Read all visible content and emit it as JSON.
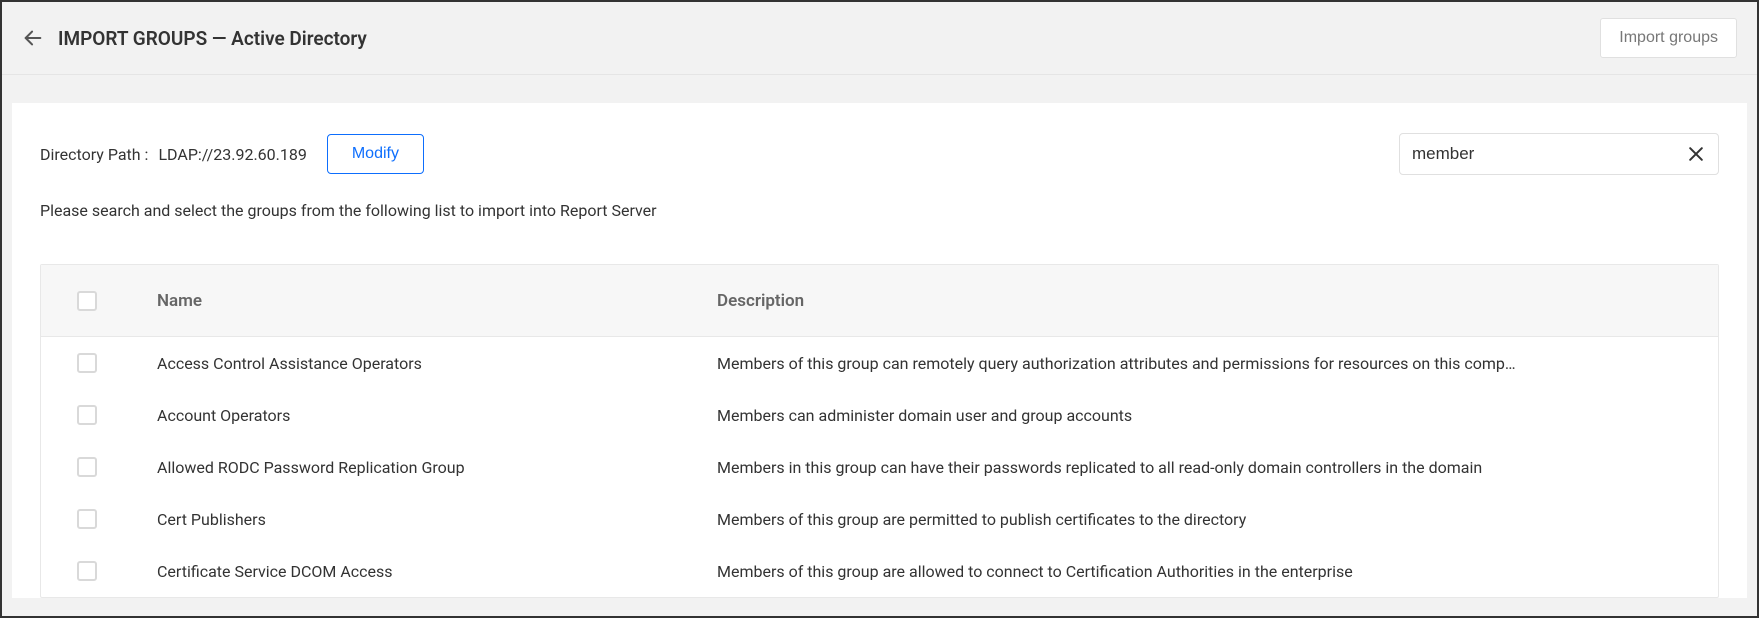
{
  "header": {
    "title": "IMPORT GROUPS — Active Directory",
    "import_button": "Import groups"
  },
  "path": {
    "label": "Directory Path :",
    "value": "LDAP://23.92.60.189",
    "modify_button": "Modify"
  },
  "search": {
    "value": "member"
  },
  "instruction": "Please search and select the groups from the following list to import into Report Server",
  "table": {
    "columns": {
      "name": "Name",
      "description": "Description"
    },
    "rows": [
      {
        "name": "Access Control Assistance Operators",
        "description": "Members of this group can remotely query authorization attributes and permissions for resources on this comp…"
      },
      {
        "name": "Account Operators",
        "description": "Members can administer domain user and group accounts"
      },
      {
        "name": "Allowed RODC Password Replication Group",
        "description": "Members in this group can have their passwords replicated to all read-only domain controllers in the domain"
      },
      {
        "name": "Cert Publishers",
        "description": "Members of this group are permitted to publish certificates to the directory"
      },
      {
        "name": "Certificate Service DCOM Access",
        "description": "Members of this group are allowed to connect to Certification Authorities in the enterprise"
      }
    ]
  }
}
